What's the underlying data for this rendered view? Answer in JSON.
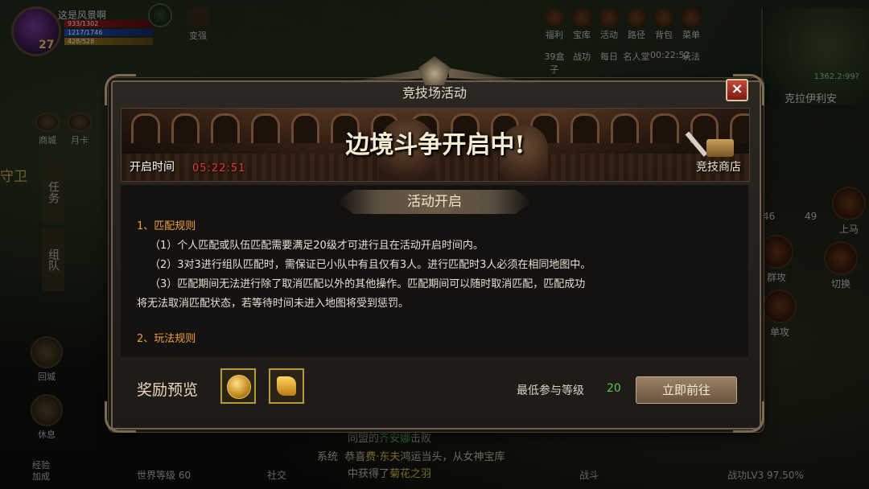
{
  "hud": {
    "player_name": "这是风景啊",
    "level": "27",
    "hp": "933/1302",
    "mp": "1217/1746",
    "exp": "428/528",
    "bianqiang": "变强",
    "top_menu": [
      "福利",
      "宝库",
      "活动",
      "路径",
      "背包",
      "菜单"
    ],
    "top_menu2": [
      "39盒子",
      "战功",
      "每日",
      "名人堂",
      "00:22:52",
      "玩法"
    ],
    "map_coord": "1362.2:99?",
    "map_name": "克拉伊利安",
    "left_guard": "守卫",
    "left_tab_task": "任务",
    "left_tab_team": "组队",
    "left_shop": "商城",
    "left_card": "月卡",
    "left_return": "回城",
    "left_rest": "休息",
    "left_exp_bonus": "经验加成",
    "right_mount": "上马",
    "right_group_attack": "群攻",
    "right_switch": "切换",
    "right_single_attack": "单攻",
    "count_left": "46",
    "count_right": "49",
    "bottom_social": "社交",
    "bottom_world_level": "世界等级 60",
    "bottom_battle": "战斗",
    "bottom_combat_power": "战功LV3 97.50%",
    "chat_line1_pre": "同盟的",
    "chat_line1_name": "齐安娜",
    "chat_line1_post": "击败",
    "chat_line2_sys": "系统",
    "chat_line2_pre": "恭喜",
    "chat_line2_name": "费·东夫",
    "chat_line2_post": "鸿运当头，从女神宝库",
    "chat_line3_pre": "中获得了",
    "chat_line3_item": "菊花之羽"
  },
  "dialog": {
    "title": "竞技场活动",
    "close_icon": "×",
    "banner_text": "边境斗争开启中!",
    "open_time_label": "开启时间",
    "open_time_value": "05:22:51",
    "shop_label": "竞技商店",
    "section_title": "活动开启",
    "rules": {
      "heading1": "1、匹配规则",
      "r1": "（1）个人匹配或队伍匹配需要满足20级才可进行且在活动开启时间内。",
      "r2": "（2）3对3进行组队匹配时，需保证已小队中有且仅有3人。进行匹配时3人必须在相同地图中。",
      "r3a": "（3）匹配期间无法进行除了取消匹配以外的其他操作。匹配期间可以随时取消匹配，匹配成功",
      "r3b": "将无法取消匹配状态，若等待时间未进入地图将受到惩罚。",
      "heading2": "2、玩法规则"
    },
    "reward_label": "奖励预览",
    "min_level_label": "最低参与等级",
    "min_level_value": "20",
    "go_button": "立即前往"
  }
}
